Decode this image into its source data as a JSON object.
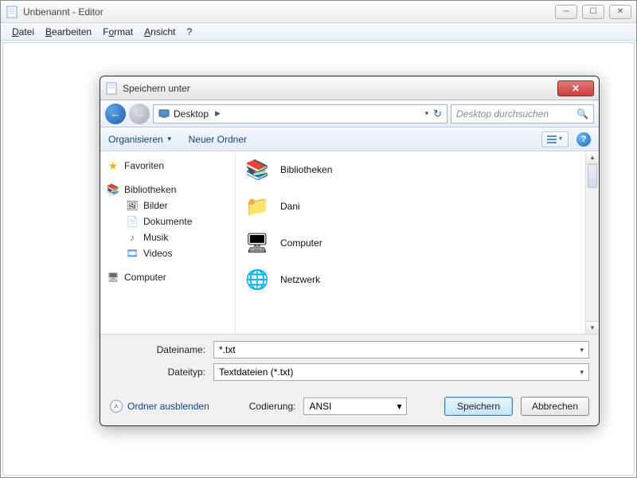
{
  "parent": {
    "title": "Unbenannt - Editor",
    "menus": {
      "datei": "Datei",
      "bearbeiten": "Bearbeiten",
      "format": "Format",
      "ansicht": "Ansicht",
      "help": "?"
    }
  },
  "dialog": {
    "title": "Speichern unter",
    "address": {
      "location": "Desktop"
    },
    "search": {
      "placeholder": "Desktop durchsuchen"
    },
    "toolbar": {
      "organize": "Organisieren",
      "new_folder": "Neuer Ordner"
    },
    "nav": {
      "favorites": "Favoriten",
      "libraries": "Bibliotheken",
      "libs": {
        "bilder": "Bilder",
        "dokumente": "Dokumente",
        "musik": "Musik",
        "videos": "Videos"
      },
      "computer": "Computer"
    },
    "items": {
      "0": "Bibliotheken",
      "1": "Dani",
      "2": "Computer",
      "3": "Netzwerk"
    },
    "fields": {
      "filename_label": "Dateiname:",
      "filename_value": "*.txt",
      "filetype_label": "Dateityp:",
      "filetype_value": "Textdateien (*.txt)"
    },
    "footer": {
      "hide_folders": "Ordner ausblenden",
      "encoding_label": "Codierung:",
      "encoding_value": "ANSI",
      "save": "Speichern",
      "cancel": "Abbrechen"
    }
  }
}
